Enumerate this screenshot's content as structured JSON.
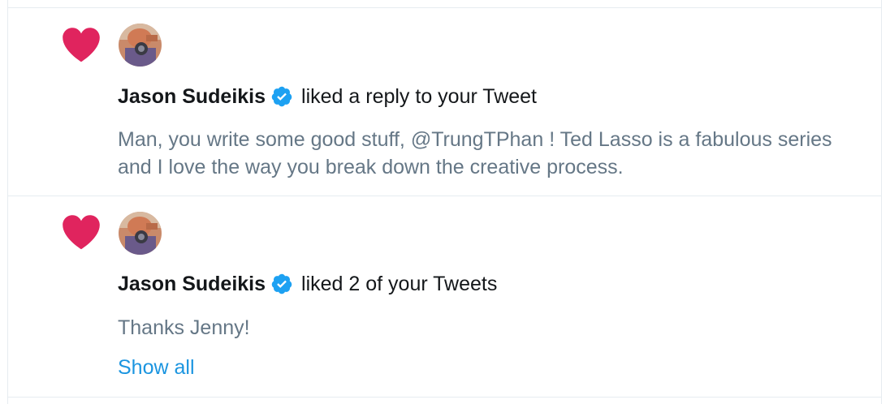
{
  "colors": {
    "heart": "#e0245e",
    "verified": "#1da1f2",
    "link": "#1b95e0",
    "primary_text": "#14171a",
    "secondary_text": "#657786",
    "divider": "#e6ecf0"
  },
  "notifications": [
    {
      "icon": "heart-icon",
      "user_name": "Jason Sudeikis",
      "verified": true,
      "action": "liked a reply to your Tweet",
      "text": "Man, you write some good stuff, @TrungTPhan !  Ted Lasso is a fabulous series and I love the way you break down the creative process."
    },
    {
      "icon": "heart-icon",
      "user_name": "Jason Sudeikis",
      "verified": true,
      "action": "liked 2 of your Tweets",
      "text": "Thanks Jenny!",
      "show_all_label": "Show all"
    }
  ]
}
